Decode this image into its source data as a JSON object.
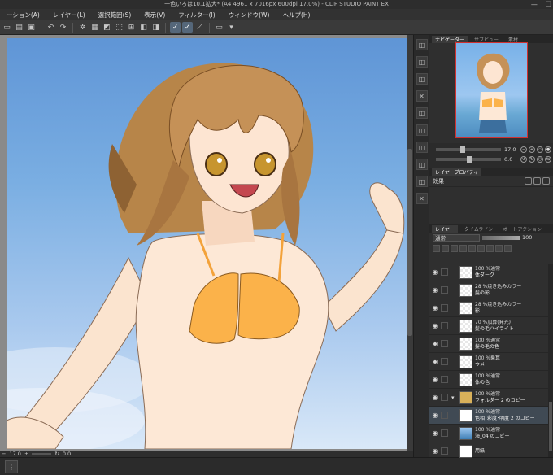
{
  "window": {
    "title": "一色いろは10.1拡大* (A4 4961 x 7016px 600dpi 17.0%) - CLIP STUDIO PAINT EX",
    "controls": [
      "—",
      "❐"
    ]
  },
  "menu": {
    "items": [
      "ーション(A)",
      "レイヤー(L)",
      "選択範囲(S)",
      "表示(V)",
      "フィルター(I)",
      "ウィンドウ(W)",
      "ヘルプ(H)"
    ]
  },
  "toolbar": {
    "icons": [
      "new-file-icon",
      "open-icon",
      "save-icon",
      "undo-icon",
      "redo-icon",
      "clear-icon",
      "transform-icon",
      "stabilizer-icon",
      "pen-tool-icon",
      "brush-tool-icon",
      "ruler-icon",
      "screen-icon"
    ]
  },
  "status": {
    "zoom": "17.0",
    "angle": "0.0"
  },
  "navigator": {
    "tabs": [
      "ナビゲーター",
      "サブビュー",
      "素材"
    ],
    "zoom_value": "17.0",
    "rotation_value": "0.0"
  },
  "properties": {
    "tabs": [
      "レイヤープロパティ"
    ],
    "effect_label": "効果"
  },
  "layer_panel": {
    "tabs": [
      "レイヤー",
      "タイムライン",
      "オートアクション"
    ],
    "blend_mode": "通常",
    "opacity": "100",
    "layers": [
      {
        "opacity": "100 %通常",
        "name": "体ダーク",
        "kind": "raster"
      },
      {
        "opacity": "28 %焼き込みカラー",
        "name": "髪の影",
        "kind": "raster"
      },
      {
        "opacity": "28 %焼き込みカラー",
        "name": "影",
        "kind": "raster"
      },
      {
        "opacity": "70 %加算(発光)",
        "name": "髪の毛ハイライト",
        "kind": "raster"
      },
      {
        "opacity": "100 %通常",
        "name": "髪の毛の色",
        "kind": "raster"
      },
      {
        "opacity": "100 %乗算",
        "name": "ウメ",
        "kind": "raster"
      },
      {
        "opacity": "100 %通常",
        "name": "体の色",
        "kind": "raster"
      },
      {
        "opacity": "100 %通常",
        "name": "フォルダー 2 のコピー",
        "kind": "folder"
      },
      {
        "opacity": "100 %通常",
        "name": "色相･彩度･明度 2 のコピー",
        "kind": "adjust"
      },
      {
        "opacity": "100 %通常",
        "name": "海_04 のコピー",
        "kind": "sea"
      },
      {
        "opacity": "",
        "name": "用紙",
        "kind": "paper"
      }
    ]
  }
}
